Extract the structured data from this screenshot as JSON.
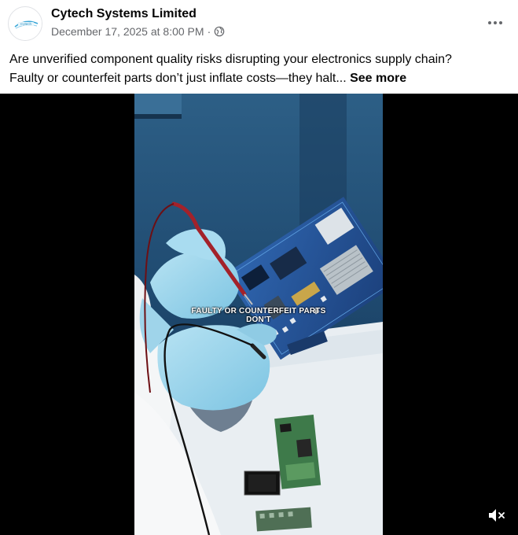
{
  "post": {
    "author": "Cytech Systems Limited",
    "avatar_icon": "cytech-logo-icon",
    "date": "December 17, 2025 at 8:00 PM",
    "separator": "·",
    "audience_icon": "globe-icon",
    "more_icon": "more-options-icon",
    "text_line1": "Are unverified component quality risks disrupting your electronics supply chain?",
    "text_line2": "Faulty or counterfeit parts don’t just inflate costs—they halt...",
    "see_more": "See more"
  },
  "video": {
    "caption_line1": "FAULTY OR COUNTERFEIT PARTS",
    "caption_line2": "DON'T",
    "mute_icon": "speaker-muted-icon"
  },
  "colors": {
    "text": "#050505",
    "secondary": "#65676b",
    "video_bg": "#000000"
  }
}
